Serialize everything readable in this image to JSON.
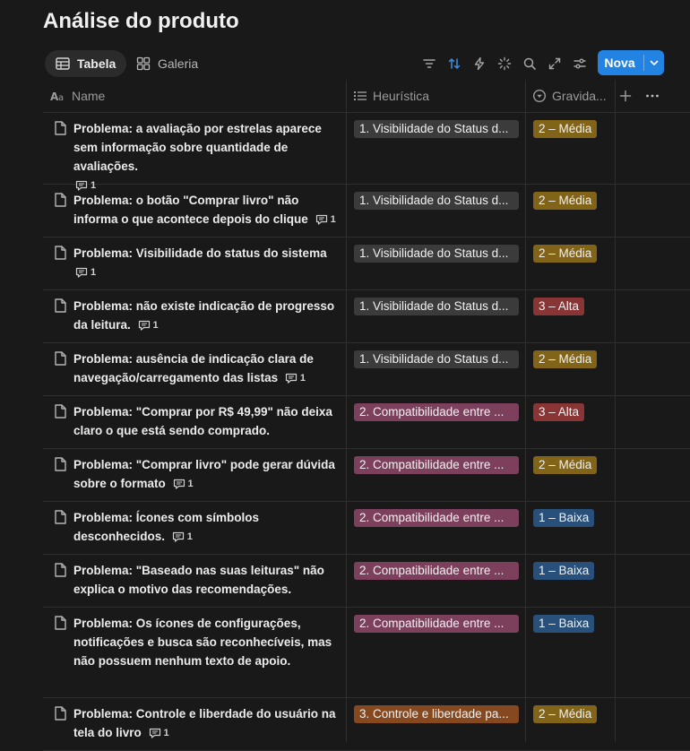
{
  "page": {
    "title": "Análise do produto"
  },
  "views": {
    "table_label": "Tabela",
    "gallery_label": "Galeria"
  },
  "toolbar": {
    "new_label": "Nova",
    "accent_color": "#2383e2",
    "icons": [
      "filter-icon",
      "sort-icon",
      "automation-icon",
      "ai-sparkle-icon",
      "search-icon",
      "expand-icon",
      "settings-sliders-icon"
    ]
  },
  "columns": {
    "name": "Name",
    "heuristic": "Heurística",
    "severity": "Gravida..."
  },
  "rows": [
    {
      "name": "Problema: a avaliação por estrelas aparece sem informação sobre quantidade de avaliações.",
      "comments": "1",
      "heuristic": "1. Visibilidade do Status d...",
      "heuristic_color": "gray",
      "severity": "2 – Média",
      "severity_color": "yellow"
    },
    {
      "name": "Problema: o botão \"Comprar livro\" não informa o que acontece depois do clique",
      "comments": "1",
      "heuristic": "1. Visibilidade do Status d...",
      "heuristic_color": "gray",
      "severity": "2 – Média",
      "severity_color": "yellow"
    },
    {
      "name": "Problema: Visibilidade do status do sistema",
      "comments": "1",
      "heuristic": "1. Visibilidade do Status d...",
      "heuristic_color": "gray",
      "severity": "2 – Média",
      "severity_color": "yellow"
    },
    {
      "name": "Problema: não existe indicação de progresso da leitura.",
      "comments": "1",
      "heuristic": "1. Visibilidade do Status d...",
      "heuristic_color": "gray",
      "severity": "3 – Alta",
      "severity_color": "red"
    },
    {
      "name": "Problema: ausência de indicação clara de navegação/carregamento das listas",
      "comments": "1",
      "heuristic": "1. Visibilidade do Status d...",
      "heuristic_color": "gray",
      "severity": "2 – Média",
      "severity_color": "yellow"
    },
    {
      "name": "Problema: \"Comprar por R$ 49,99\" não deixa claro o que está sendo comprado.",
      "comments": "",
      "heuristic": "2. Compatibilidade entre ...",
      "heuristic_color": "pink",
      "severity": "3 – Alta",
      "severity_color": "red"
    },
    {
      "name": "Problema: \"Comprar livro\" pode gerar dúvida sobre o formato",
      "comments": "1",
      "heuristic": "2. Compatibilidade entre ...",
      "heuristic_color": "pink",
      "severity": "2 – Média",
      "severity_color": "yellow"
    },
    {
      "name": "Problema: Ícones com símbolos desconhecidos.",
      "comments": "1",
      "heuristic": "2. Compatibilidade entre ...",
      "heuristic_color": "pink",
      "severity": "1 – Baixa",
      "severity_color": "blue"
    },
    {
      "name": "Problema: \"Baseado nas suas leituras\" não explica o motivo das recomendações.",
      "comments": "",
      "heuristic": "2. Compatibilidade entre ...",
      "heuristic_color": "pink",
      "severity": "1 – Baixa",
      "severity_color": "blue"
    },
    {
      "name": "Problema: Os ícones de configurações, notificações e busca são reconhecíveis, mas não possuem nenhum texto de apoio.",
      "comments": "",
      "heuristic": "2. Compatibilidade entre ...",
      "heuristic_color": "pink",
      "severity": "1 – Baixa",
      "severity_color": "blue"
    },
    {
      "name": "Problema: Controle e liberdade do usuário na tela do livro",
      "comments": "1",
      "heuristic": "3. Controle e liberdade pa...",
      "heuristic_color": "orange",
      "severity": "2 – Média",
      "severity_color": "yellow"
    }
  ]
}
